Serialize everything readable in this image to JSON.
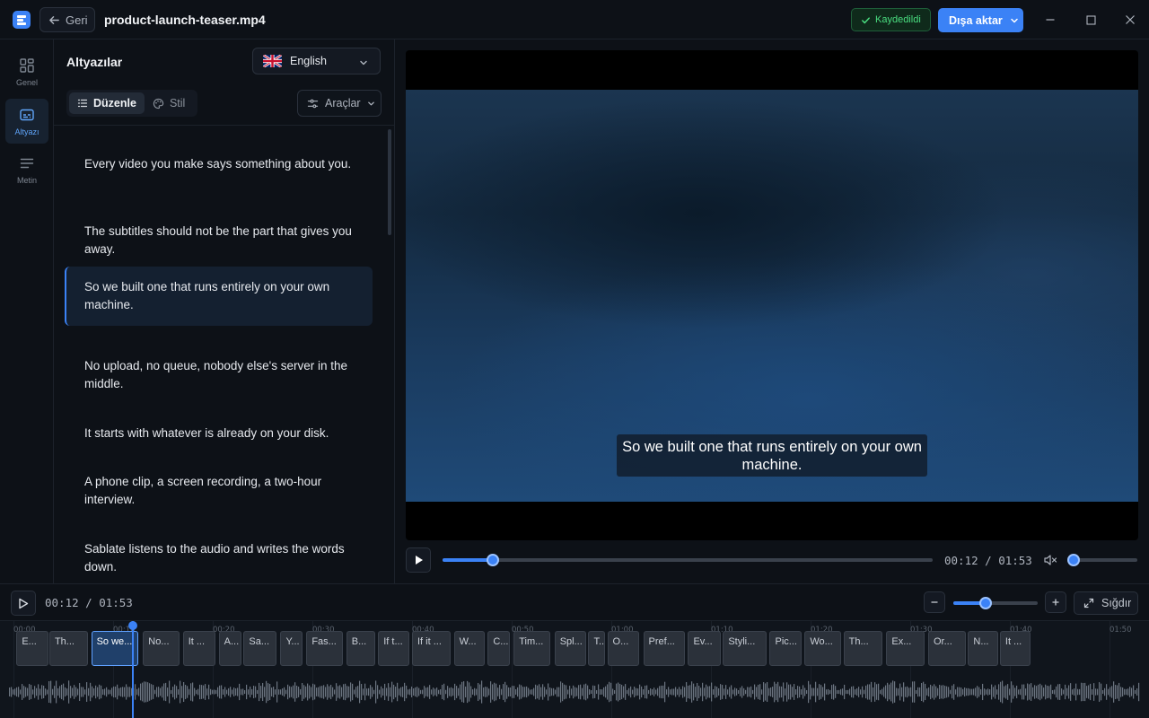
{
  "window": {
    "back_label": "Geri",
    "file_name": "product-launch-teaser.mp4",
    "saved_label": "Kaydedildi",
    "export_label": "Dışa aktar",
    "icons": [
      "logo-icon",
      "arrow-left-icon",
      "check-icon",
      "chevron-down-icon",
      "minimize-icon",
      "maximize-icon",
      "close-icon"
    ]
  },
  "rail": {
    "items": [
      {
        "label": "Genel",
        "icon": "grid-icon",
        "active": false
      },
      {
        "label": "Altyazı",
        "icon": "subtitles-icon",
        "active": true
      },
      {
        "label": "Metin",
        "icon": "text-lines-icon",
        "active": false
      }
    ]
  },
  "subtitles_panel": {
    "title": "Altyazılar",
    "language": "English",
    "language_flag": "uk-flag-icon",
    "tabs": [
      {
        "label": "Düzenle",
        "icon": "list-icon",
        "active": true
      },
      {
        "label": "Stil",
        "icon": "palette-icon",
        "active": false
      }
    ],
    "tools_label": "Araçlar",
    "cues": [
      {
        "text": "Every video you make says something about you.",
        "active": false
      },
      {
        "text": "The subtitles should not be the part that gives you away.",
        "active": false
      },
      {
        "text": "So we built one that runs entirely on your own machine.",
        "active": true
      },
      {
        "text": "No upload, no queue, nobody else's server in the middle.",
        "active": false
      },
      {
        "text": "It starts with whatever is already on your disk.",
        "active": false
      },
      {
        "text": "A phone clip, a screen recording, a two-hour interview.",
        "active": false
      },
      {
        "text": "Sablate listens to the audio and writes the words down.",
        "active": false
      }
    ]
  },
  "player": {
    "caption": "So we built one that runs entirely on your own machine.",
    "current_time": "00:12",
    "duration": "01:53",
    "time_display": "00:12 / 01:53",
    "progress_fraction": 0.103,
    "volume_fraction": 0.0,
    "muted": true,
    "accent_color": "#3b82f6"
  },
  "timeline": {
    "time_display": "00:12 / 01:53",
    "fit_label": "Sığdır",
    "zoom_fraction": 0.38,
    "seconds_total": 113,
    "playhead_seconds": 12,
    "ticks": [
      "00:00",
      "00:10",
      "00:20",
      "00:30",
      "00:40",
      "00:50",
      "01:00",
      "01:10",
      "01:20",
      "01:30",
      "01:40",
      "01:50"
    ],
    "clips": [
      {
        "label": "E...",
        "start": 0.3,
        "end": 3.5
      },
      {
        "label": "Th...",
        "start": 3.6,
        "end": 7.5
      },
      {
        "label": "So we...",
        "start": 7.8,
        "end": 12.5,
        "active": true
      },
      {
        "label": "No...",
        "start": 13.0,
        "end": 16.7
      },
      {
        "label": "It ...",
        "start": 17.0,
        "end": 20.3
      },
      {
        "label": "A...",
        "start": 20.6,
        "end": 22.9
      },
      {
        "label": "Sa...",
        "start": 23.1,
        "end": 26.4
      },
      {
        "label": "Y...",
        "start": 26.8,
        "end": 29.0
      },
      {
        "label": "Fas...",
        "start": 29.4,
        "end": 33.1
      },
      {
        "label": "B...",
        "start": 33.4,
        "end": 36.3
      },
      {
        "label": "If t...",
        "start": 36.6,
        "end": 39.7
      },
      {
        "label": "If it ...",
        "start": 40.0,
        "end": 43.9
      },
      {
        "label": "W...",
        "start": 44.2,
        "end": 47.3
      },
      {
        "label": "C...",
        "start": 47.6,
        "end": 49.8
      },
      {
        "label": "Tim...",
        "start": 50.2,
        "end": 53.9
      },
      {
        "label": "Spl...",
        "start": 54.3,
        "end": 57.5
      },
      {
        "label": "T...",
        "start": 57.7,
        "end": 59.4
      },
      {
        "label": "O...",
        "start": 59.6,
        "end": 62.8
      },
      {
        "label": "Pref...",
        "start": 63.2,
        "end": 67.4
      },
      {
        "label": "Ev...",
        "start": 67.7,
        "end": 71.0
      },
      {
        "label": "Styli...",
        "start": 71.2,
        "end": 75.6
      },
      {
        "label": "Pic...",
        "start": 75.9,
        "end": 79.1
      },
      {
        "label": "Wo...",
        "start": 79.4,
        "end": 83.1
      },
      {
        "label": "Th...",
        "start": 83.3,
        "end": 87.2
      },
      {
        "label": "Ex...",
        "start": 87.6,
        "end": 91.4
      },
      {
        "label": "Or...",
        "start": 91.8,
        "end": 95.6
      },
      {
        "label": "N...",
        "start": 95.8,
        "end": 98.8
      },
      {
        "label": "It ...",
        "start": 99.0,
        "end": 102.1
      }
    ]
  }
}
